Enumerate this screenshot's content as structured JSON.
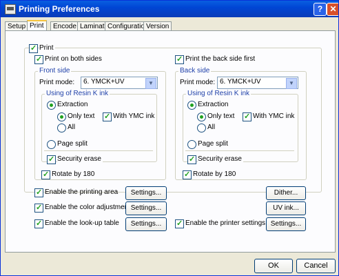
{
  "window": {
    "title": "Printing Preferences",
    "help_glyph": "?",
    "close_glyph": "✕"
  },
  "tabs": [
    "Setup",
    "Print",
    "Encode",
    "Laminate",
    "Configuration",
    "Version"
  ],
  "print": {
    "label": "Print",
    "both_sides": "Print on both sides",
    "back_first": "Print the back side first",
    "front": {
      "title": "Front side",
      "mode_label": "Print mode:",
      "mode_value": "6. YMCK+UV",
      "resin_title": "Using of Resin K ink",
      "extraction": "Extraction",
      "only_text": "Only text",
      "with_ymc": "With YMC ink",
      "all": "All",
      "page_split": "Page split",
      "security_erase": "Security erase",
      "rotate": "Rotate by 180"
    },
    "back": {
      "title": "Back side",
      "mode_label": "Print mode:",
      "mode_value": "6. YMCK+UV",
      "resin_title": "Using of Resin K ink",
      "extraction": "Extraction",
      "only_text": "Only text",
      "with_ymc": "With YMC ink",
      "all": "All",
      "page_split": "Page split",
      "security_erase": "Security erase",
      "rotate": "Rotate by 180"
    }
  },
  "options": {
    "printing_area": "Enable the printing area",
    "color_adjustment": "Enable the color adjustment",
    "lookup_table": "Enable the look-up table",
    "printer_settings": "Enable the printer settings",
    "settings": "Settings...",
    "dither": "Dither...",
    "uv_ink": "UV ink..."
  },
  "footer": {
    "ok": "OK",
    "cancel": "Cancel"
  }
}
